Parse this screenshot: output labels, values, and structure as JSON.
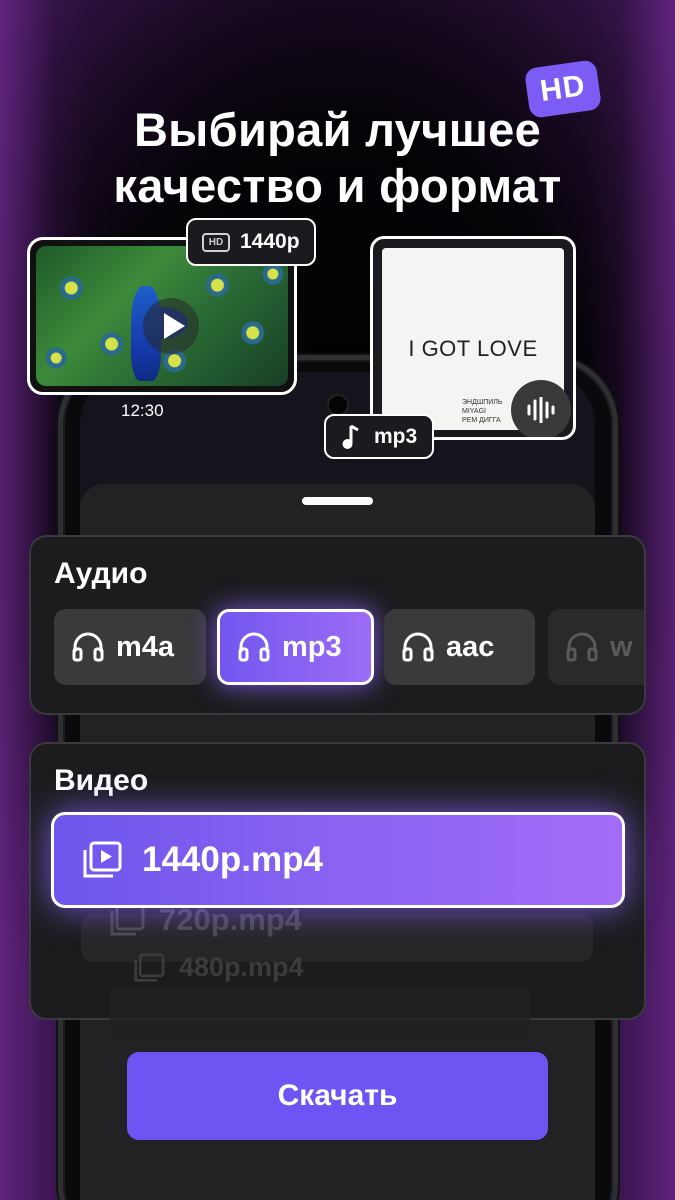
{
  "headline": {
    "line1": "Выбирай лучшее",
    "line2": "качество и формат",
    "badge": "HD"
  },
  "phone": {
    "status_time": "12:30"
  },
  "video_preview": {
    "resolution_badge": "1440p",
    "hd_icon_text": "HD"
  },
  "audio_preview": {
    "album_title": "I GOT LOVE",
    "credits": [
      "ЭНДШПИЛЬ",
      "MIYAGI",
      "РЕМ ДИГГА"
    ],
    "format_badge": "mp3"
  },
  "audio_section": {
    "title": "Аудио",
    "formats": [
      {
        "label": "m4a",
        "selected": false
      },
      {
        "label": "mp3",
        "selected": true
      },
      {
        "label": "aac",
        "selected": false
      },
      {
        "label": "w",
        "selected": false
      }
    ]
  },
  "video_section": {
    "title": "Видео",
    "selected": "1440p.mp4",
    "options": [
      "720p.mp4",
      "480p.mp4"
    ]
  },
  "download_button": "Скачать",
  "colors": {
    "accent": "#6d55f3",
    "accent_light": "#a36cf7",
    "panel": "#1c1c1e",
    "chip": "#3a3a3c"
  }
}
